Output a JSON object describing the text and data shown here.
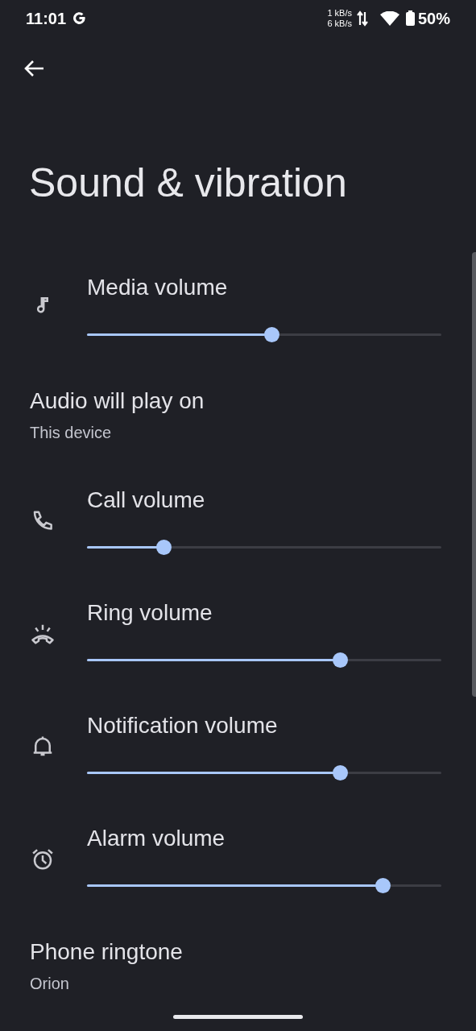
{
  "status_bar": {
    "time": "11:01",
    "upload_speed": "1 kB/s",
    "download_speed": "6 kB/s",
    "battery": "50%"
  },
  "title": "Sound & vibration",
  "items": [
    {
      "kind": "slider",
      "label": "Media volume",
      "level": 0.52
    },
    {
      "kind": "text",
      "label": "Audio will play on",
      "summary": "This device"
    },
    {
      "kind": "slider",
      "label": "Call volume",
      "level": 0.216
    },
    {
      "kind": "slider",
      "label": "Ring volume",
      "level": 0.714
    },
    {
      "kind": "slider",
      "label": "Notification volume",
      "level": 0.714
    },
    {
      "kind": "slider",
      "label": "Alarm volume",
      "level": 0.834
    },
    {
      "kind": "text",
      "label": "Phone ringtone",
      "summary": "Orion"
    }
  ]
}
